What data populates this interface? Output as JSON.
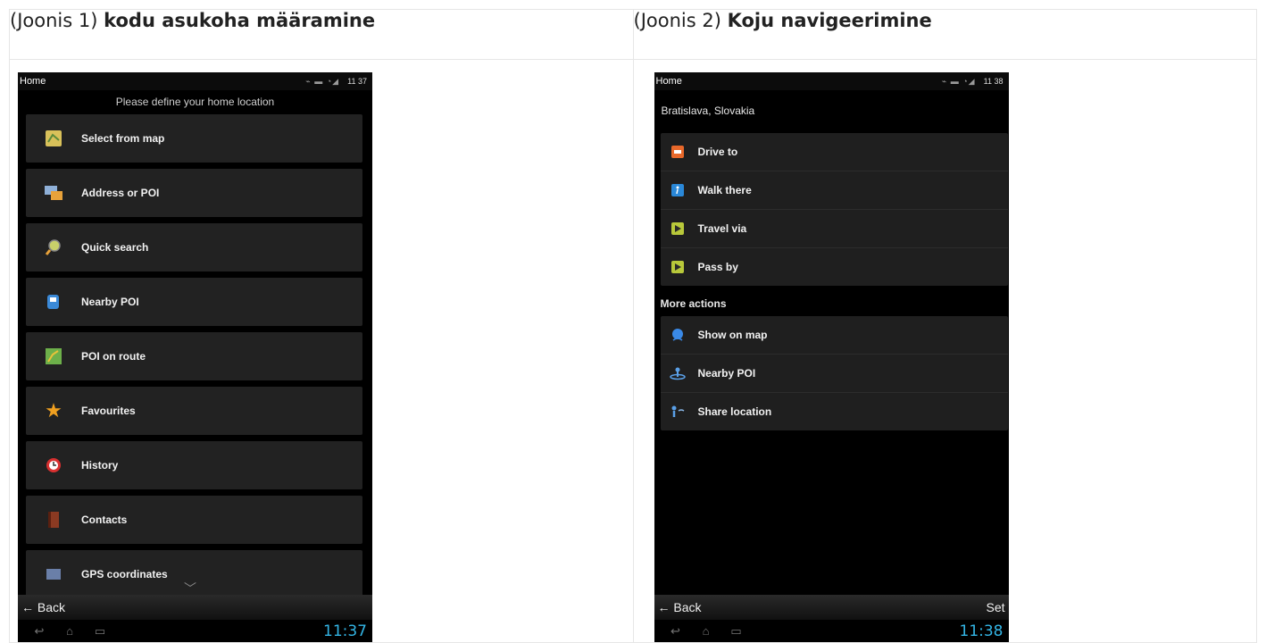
{
  "figure1": {
    "caption_prefix": "(Joonis 1)",
    "caption_title": "kodu asukoha määramine",
    "screen": {
      "title": "Home",
      "status_signal": "⌁ ▬ ◔◢",
      "status_time": "11 37",
      "prompt": "Please define your home location",
      "items": [
        {
          "label": "Select from map",
          "icon": "map-icon",
          "color": "#d9c15a"
        },
        {
          "label": "Address or POI",
          "icon": "address-icon",
          "color": "#e8a23a"
        },
        {
          "label": "Quick search",
          "icon": "magnifier-icon",
          "color": "#c8d06a"
        },
        {
          "label": "Nearby POI",
          "icon": "fuel-pump-icon",
          "color": "#3b8ad8"
        },
        {
          "label": "POI on route",
          "icon": "route-icon",
          "color": "#6db04a"
        },
        {
          "label": "Favourites",
          "icon": "star-icon",
          "color": "#f0a020"
        },
        {
          "label": "History",
          "icon": "clock-icon",
          "color": "#d83030"
        },
        {
          "label": "Contacts",
          "icon": "contacts-book-icon",
          "color": "#8a3a22"
        },
        {
          "label": "GPS coordinates",
          "icon": "gps-icon",
          "color": "#6a7fa8"
        }
      ],
      "back_label": "← Back",
      "clock": "11:37"
    }
  },
  "figure2": {
    "caption_prefix": "(Joonis 2)",
    "caption_title": "Koju navigeerimine",
    "screen": {
      "title": "Home",
      "status_signal": "⌁ ▬ ◔◢",
      "status_time": "11 38",
      "location": "Bratislava, Slovakia",
      "actions": [
        {
          "label": "Drive to",
          "icon": "car-icon",
          "color": "#e8682a"
        },
        {
          "label": "Walk there",
          "icon": "walk-icon",
          "color": "#2a88d8"
        },
        {
          "label": "Travel via",
          "icon": "via-arrow-icon",
          "color": "#b8c83a"
        },
        {
          "label": "Pass by",
          "icon": "pass-arrow-icon",
          "color": "#b8c83a"
        }
      ],
      "more_actions_label": "More actions",
      "more_actions": [
        {
          "label": "Show on map",
          "icon": "map-pin-icon",
          "color": "#3a8ae8"
        },
        {
          "label": "Nearby POI",
          "icon": "nearby-poi-icon",
          "color": "#5aa0e8"
        },
        {
          "label": "Share location",
          "icon": "share-icon",
          "color": "#5aa0e8"
        }
      ],
      "back_label": "← Back",
      "set_label": "Set",
      "clock": "11:38"
    }
  }
}
